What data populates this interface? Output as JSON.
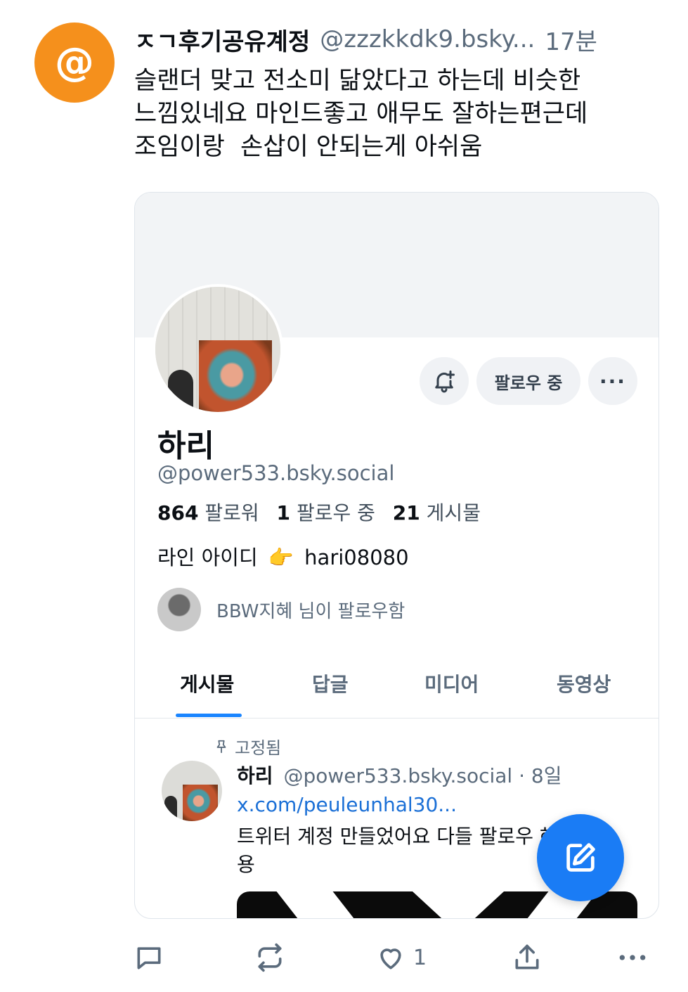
{
  "post": {
    "avatar_symbol": "@",
    "author_name": "ㅈㄱ후기공유계정",
    "author_handle": "@zzzkkdk9.bsky...",
    "time": "17분",
    "body": "슬랜더 맞고 전소미 닮았다고 하는데 비슷한\n느낌있네요 마인드좋고 애무도 잘하는편근데\n조임이랑  손삽이 안되는게 아쉬움",
    "avatar_color": "#f5901c"
  },
  "embed": {
    "follow_button": "팔로우 중",
    "more_button": "···",
    "display_name": "하리",
    "handle": "@power533.bsky.social",
    "stats": {
      "followers_count": "864",
      "followers_label": "팔로워",
      "following_count": "1",
      "following_label": "팔로우 중",
      "posts_count": "21",
      "posts_label": "게시물"
    },
    "bio_prefix": "라인 아이디",
    "bio_emoji": "👉",
    "bio_id": "hari08080",
    "followed_by": "BBW지혜 님이 팔로우함",
    "tabs": [
      "게시물",
      "답글",
      "미디어",
      "동영상"
    ],
    "pinned_label": "고정됨",
    "pinned_post": {
      "name": "하리",
      "meta": "@power533.bsky.social · 8일",
      "link": "x.com/peuleunhal30...",
      "text_line1": "트위터 계정 만들었어요 다들 팔로우 해주세요",
      "text_line2": "용"
    }
  },
  "actions": {
    "like_count": "1"
  },
  "colors": {
    "accent": "#1a7cf5",
    "muted": "#5b6b7c"
  }
}
